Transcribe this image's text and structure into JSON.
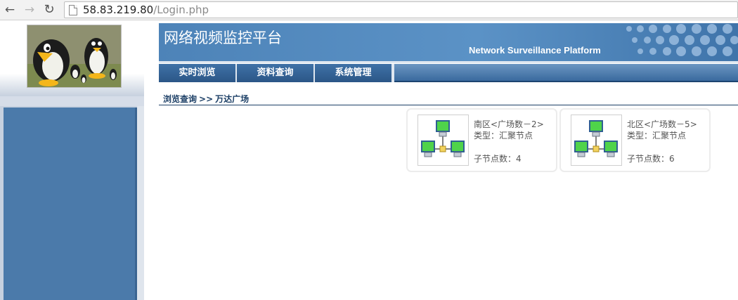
{
  "browser": {
    "url_host": "58.83.219.80",
    "url_path": "/Login.php",
    "icons": [
      "back-arrow-icon",
      "forward-arrow-icon",
      "reload-icon",
      "page-icon"
    ]
  },
  "header": {
    "title": "网络视频监控平台",
    "subtitle": "Network Surveillance Platform"
  },
  "menu": {
    "items": [
      {
        "label": "实时浏览"
      },
      {
        "label": "资料查询"
      },
      {
        "label": "系统管理"
      }
    ]
  },
  "breadcrumb": {
    "first": "浏览查询",
    "separator": ">>",
    "current": "万达广场"
  },
  "nodes": [
    {
      "name": "南区<广场数－2>",
      "type": "类型：汇聚节点",
      "child_count": "子节点数：4",
      "icon": "network-topology-icon"
    },
    {
      "name": "北区<广场数－5>",
      "type": "类型：汇聚节点",
      "child_count": "子节点数：6",
      "icon": "network-topology-icon"
    }
  ],
  "colors": {
    "banner": "#4d83b8",
    "menu": "#3a6a9e",
    "sidebar_panel": "#4b7aaa",
    "breadcrumb_text": "#1c3f66"
  }
}
